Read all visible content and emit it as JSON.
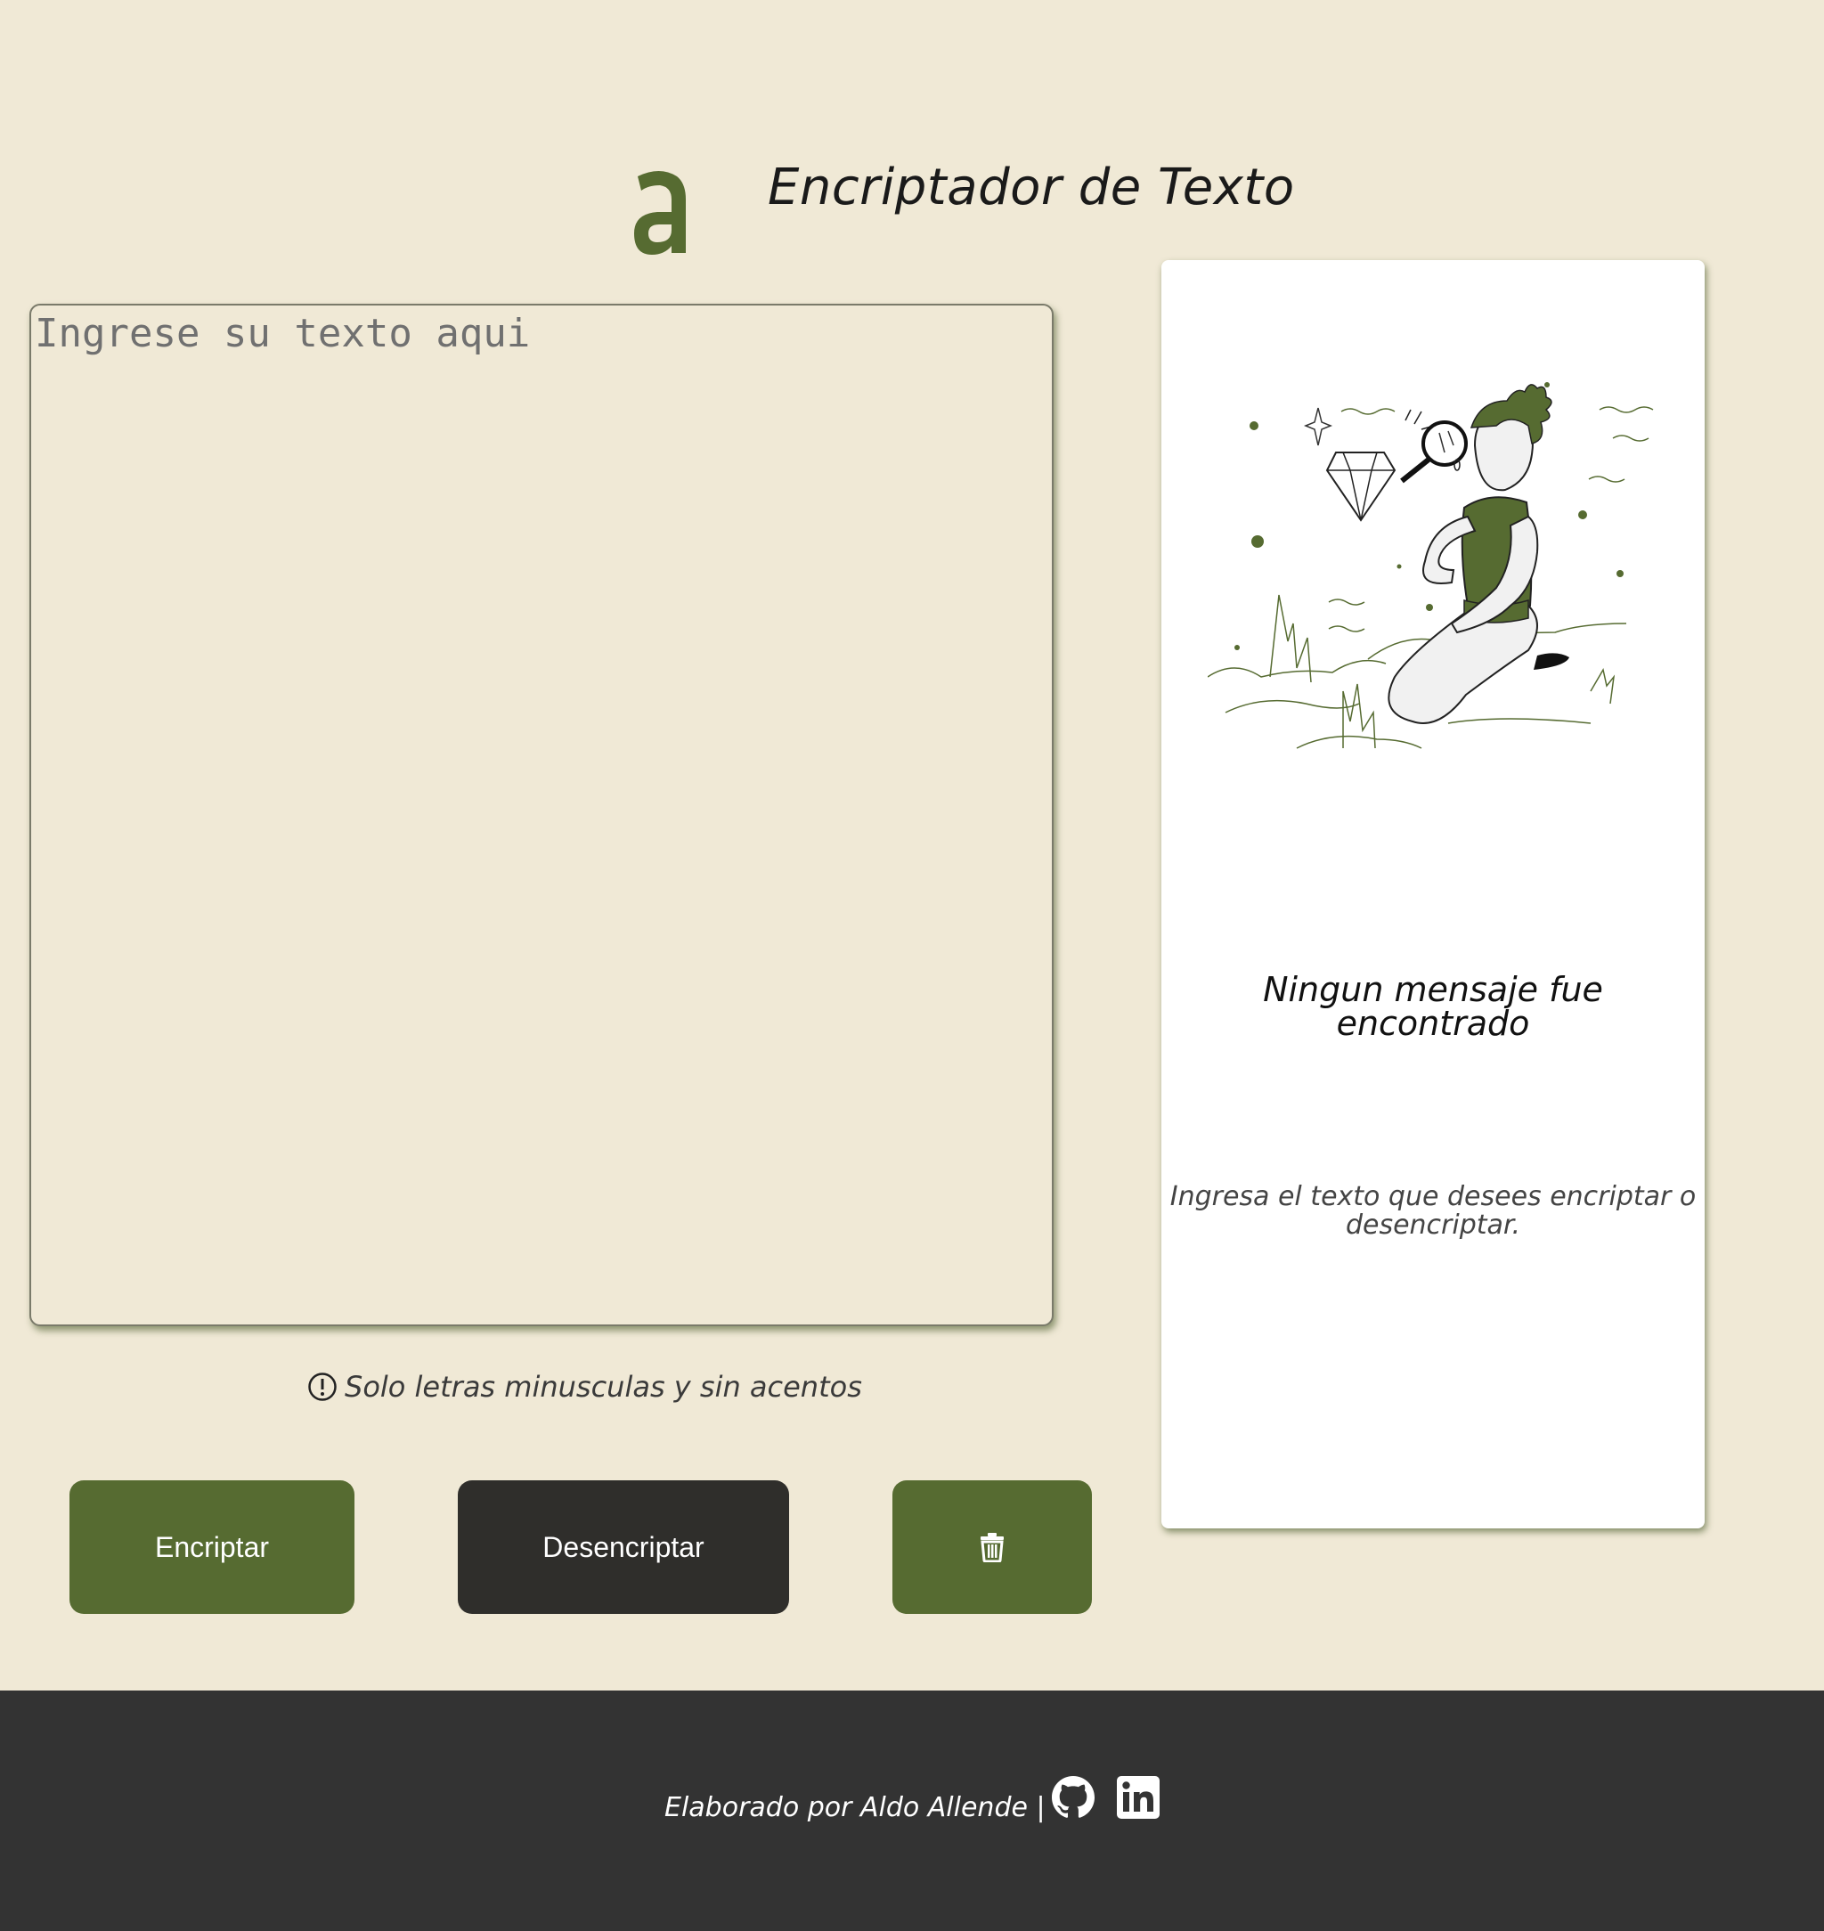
{
  "header": {
    "logo_letter": "a",
    "title": "Encriptador de Texto"
  },
  "input": {
    "placeholder": "Ingrese su texto aqui",
    "value": ""
  },
  "hint": {
    "icon": "exclamation-circle-icon",
    "text": "Solo letras minusculas y sin acentos"
  },
  "buttons": {
    "encrypt_label": "Encriptar",
    "decrypt_label": "Desencriptar",
    "clear_icon": "trash-icon"
  },
  "output_card": {
    "illustration": "person-searching-with-magnifier-illustration",
    "title": "Ningun mensaje fue encontrado",
    "subtitle": "Ingresa el texto que desees encriptar o desencriptar."
  },
  "footer": {
    "credit": "Elaborado por Aldo Allende |",
    "icons": [
      "github-icon",
      "linkedin-icon"
    ]
  },
  "colors": {
    "background": "#f0e9d6",
    "accent": "#566b31",
    "dark": "#2f2e2b",
    "footer": "#333333"
  }
}
